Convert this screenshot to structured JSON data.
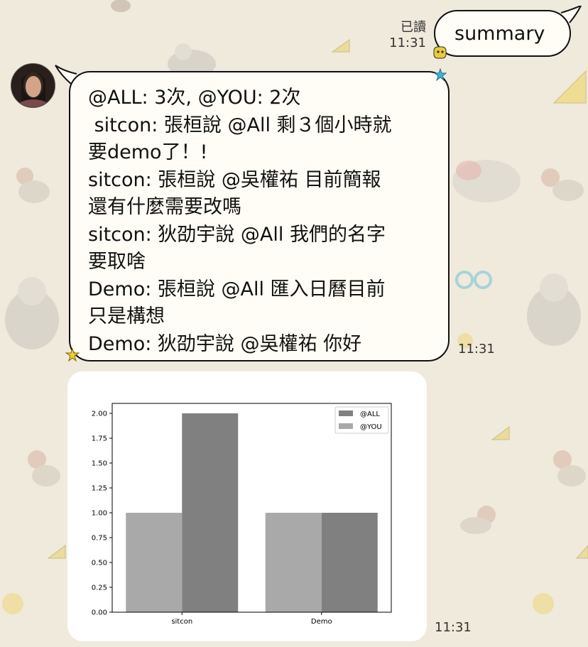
{
  "sent": {
    "read_label": "已讀",
    "time": "11:31",
    "text": "summary"
  },
  "received": {
    "avatar_icon": "profile-photo-avatar",
    "lines": [
      "@ALL: 3次, @YOU: 2次",
      " sitcon: 張桓說 @All 剩３個小時就",
      "要demo了！!",
      "sitcon: 張桓說 @吳權祐 目前簡報",
      "還有什麼需要改嗎",
      "sitcon: 狄劭宇說 @All 我們的名字",
      "要取啥",
      "Demo: 張桓說 @All 匯入日曆目前",
      "只是構想",
      "Demo: 狄劭宇說 @吳權祐 你好"
    ],
    "time": "11:31"
  },
  "image_message": {
    "time": "11:31"
  },
  "colors": {
    "background": "#efeadb",
    "bubble": "#fffdf5",
    "bar_all": "#808080",
    "bar_you": "#a9a9a9"
  },
  "chart_data": {
    "type": "bar",
    "categories": [
      "sitcon",
      "Demo"
    ],
    "series": [
      {
        "name": "@ALL",
        "values": [
          2,
          1
        ]
      },
      {
        "name": "@YOU",
        "values": [
          1,
          1
        ]
      }
    ],
    "ylim": [
      0,
      2.1
    ],
    "yticks": [
      "0.00",
      "0.25",
      "0.50",
      "0.75",
      "1.00",
      "1.25",
      "1.50",
      "1.75",
      "2.00"
    ],
    "legend_position": "top-right",
    "title": "",
    "xlabel": "",
    "ylabel": ""
  }
}
